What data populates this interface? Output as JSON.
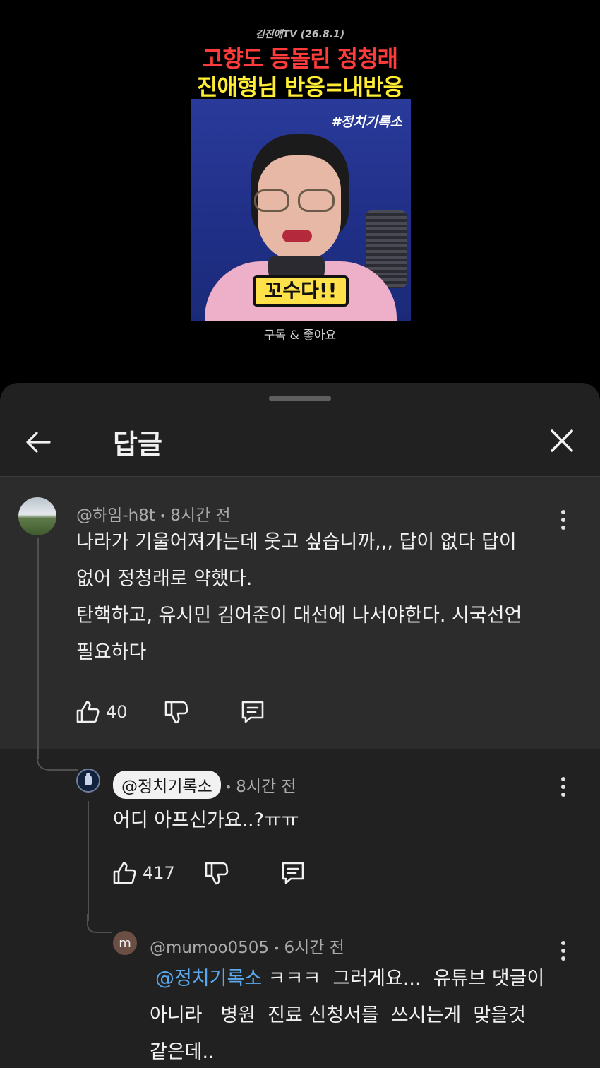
{
  "video": {
    "channel_tag": "김진애TV (26.8.1)",
    "headline_line1": "고향도 등돌린 정청래",
    "headline_line2": "진애형님 반응=내반응",
    "hashtag": "#정치기록소",
    "caption": "꼬수다!!",
    "subscribe_text": "구독 & 좋아요"
  },
  "sheet": {
    "title": "답글"
  },
  "comments": [
    {
      "handle": "@하임-h8t",
      "time": "8시간 전",
      "lines": [
        "나라가 기울어져가는데 웃고 싶습니까,,, 답이 없다 답이",
        "없어 정청래로 약했다.",
        "탄핵하고, 유시민 김어준이 대선에 나서야한다. 시국선언",
        "필요하다"
      ],
      "likes": "40"
    },
    {
      "handle": "@정치기록소",
      "time": "8시간 전",
      "lines": [
        "어디 아프신가요..?ㅠㅠ"
      ],
      "likes": "417"
    },
    {
      "avatar_letter": "m",
      "handle": "@mumoo0505",
      "time": "6시간 전",
      "mention": "@정치기록소",
      "first_line_rest": " ㅋㅋㅋ  그러게요...  유튜브 댓글이",
      "lines": [
        "아니라   병원  진료 신청서를  쓰시는게  맞을것",
        "같은데.."
      ]
    }
  ],
  "colors": {
    "background": "#000000",
    "sheet": "#212121",
    "highlighted_comment": "#2c2c2c",
    "mention": "#5aa9ee",
    "headline_red": "#ff3b3b",
    "headline_yellow": "#ffee33"
  },
  "icons": [
    "arrow-left-icon",
    "close-icon",
    "more-vert-icon",
    "thumb-up-icon",
    "thumb-down-icon",
    "reply-icon"
  ]
}
